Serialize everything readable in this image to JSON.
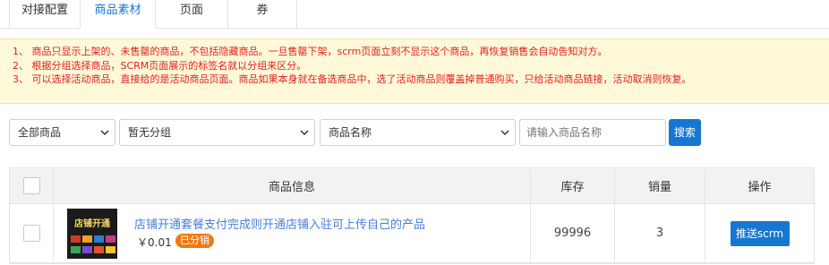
{
  "tabs": [
    {
      "label": "对接配置",
      "active": false
    },
    {
      "label": "商品素材",
      "active": true
    },
    {
      "label": "页面",
      "active": false
    },
    {
      "label": "券",
      "active": false
    }
  ],
  "notice": {
    "lines": [
      "1、 商品只显示上架的、未售罄的商品，不包括隐藏商品。一旦售罄下架，scrm页面立刻不显示这个商品，再恢复销售会自动告知对方。",
      "2、 根据分组选择商品，SCRM页面展示的标签名就以分组来区分。",
      "3、 可以选择活动商品，直接给的是活动商品页面。商品如果本身就在备选商品中，选了活动商品则覆盖掉普通购买，只给活动商品链接，活动取消则恢复。"
    ],
    "color": "#e02020"
  },
  "filters": {
    "type_select": "全部商品",
    "group_select": "暂无分组",
    "field_select": "商品名称",
    "keyword_placeholder": "请输入商品名称",
    "search_label": "搜索"
  },
  "table": {
    "headers": {
      "info": "商品信息",
      "stock": "库存",
      "sales": "销量",
      "action": "操作"
    },
    "rows": [
      {
        "thumb_text": "店铺开通",
        "name": "店铺开通套餐支付完成则开通店铺入驻可上传自己的产品",
        "price": "￥0.01",
        "badge": "已分销",
        "stock": "99996",
        "sales": "3",
        "action": "推送scrm"
      }
    ]
  },
  "colors": {
    "accent": "#1677d2",
    "badge": "#f07b12",
    "link": "#4a7ed6",
    "notice_bg": "#fff9d9"
  }
}
